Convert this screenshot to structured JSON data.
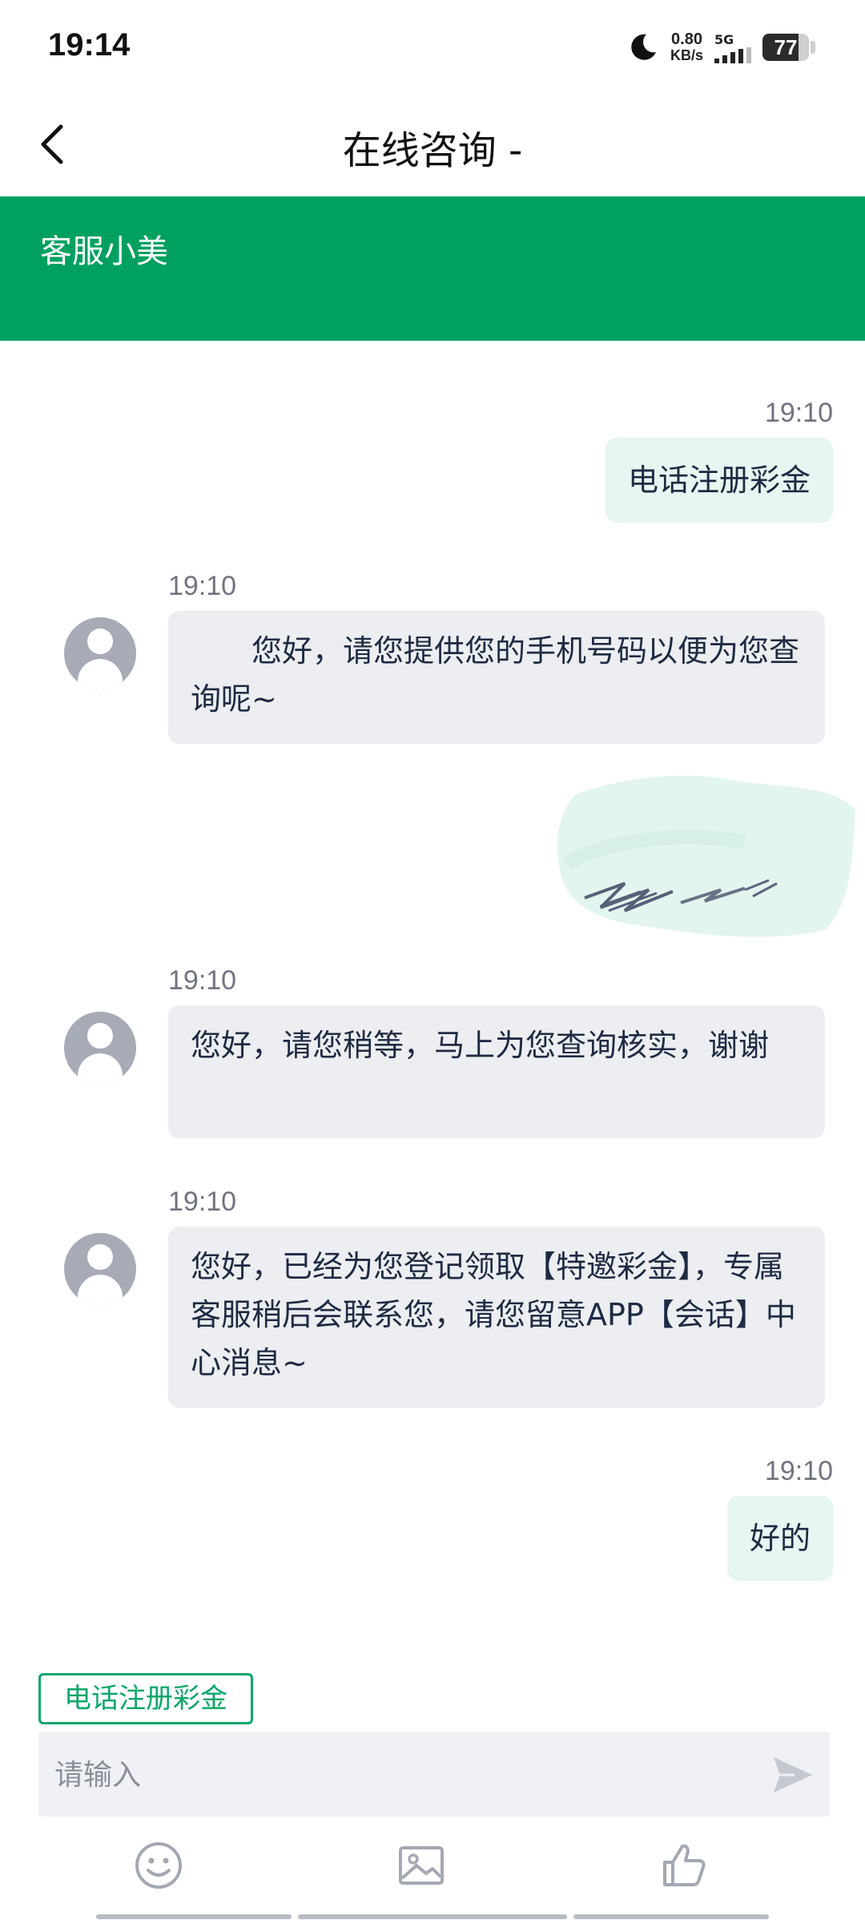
{
  "status_bar": {
    "time": "19:14",
    "net_speed_value": "0.80",
    "net_speed_unit": "KB/s",
    "network": "5G",
    "battery_level": "77",
    "battery_fraction": 0.77
  },
  "header": {
    "title": "在线咨询 -"
  },
  "banner": {
    "agent_name": "客服小美"
  },
  "messages": [
    {
      "sender": "me",
      "time": "19:10",
      "text": "电话注册彩金"
    },
    {
      "sender": "agent",
      "time": "19:10",
      "text": "　　您好，请您提供您的手机号码以便为您查询呢~"
    },
    {
      "sender": "me",
      "redacted": true
    },
    {
      "sender": "agent",
      "time": "19:10",
      "text": "您好，请您稍等，马上为您查询核实，谢谢"
    },
    {
      "sender": "agent",
      "time": "19:10",
      "text": "您好，已经为您登记领取【特邀彩金】，专属客服稍后会联系您，请您留意APP【会话】中心消息~"
    },
    {
      "sender": "me",
      "time": "19:10",
      "text": "好的"
    }
  ],
  "quick_reply": {
    "label": "电话注册彩金"
  },
  "composer": {
    "placeholder": "请输入",
    "value": ""
  },
  "toolbar": {
    "icons": [
      "emoji-icon",
      "image-icon",
      "thumbs-up-icon"
    ]
  },
  "colors": {
    "brand_green": "#00a060",
    "my_bubble": "#e6f6f0",
    "agent_bubble": "#eceef1"
  }
}
